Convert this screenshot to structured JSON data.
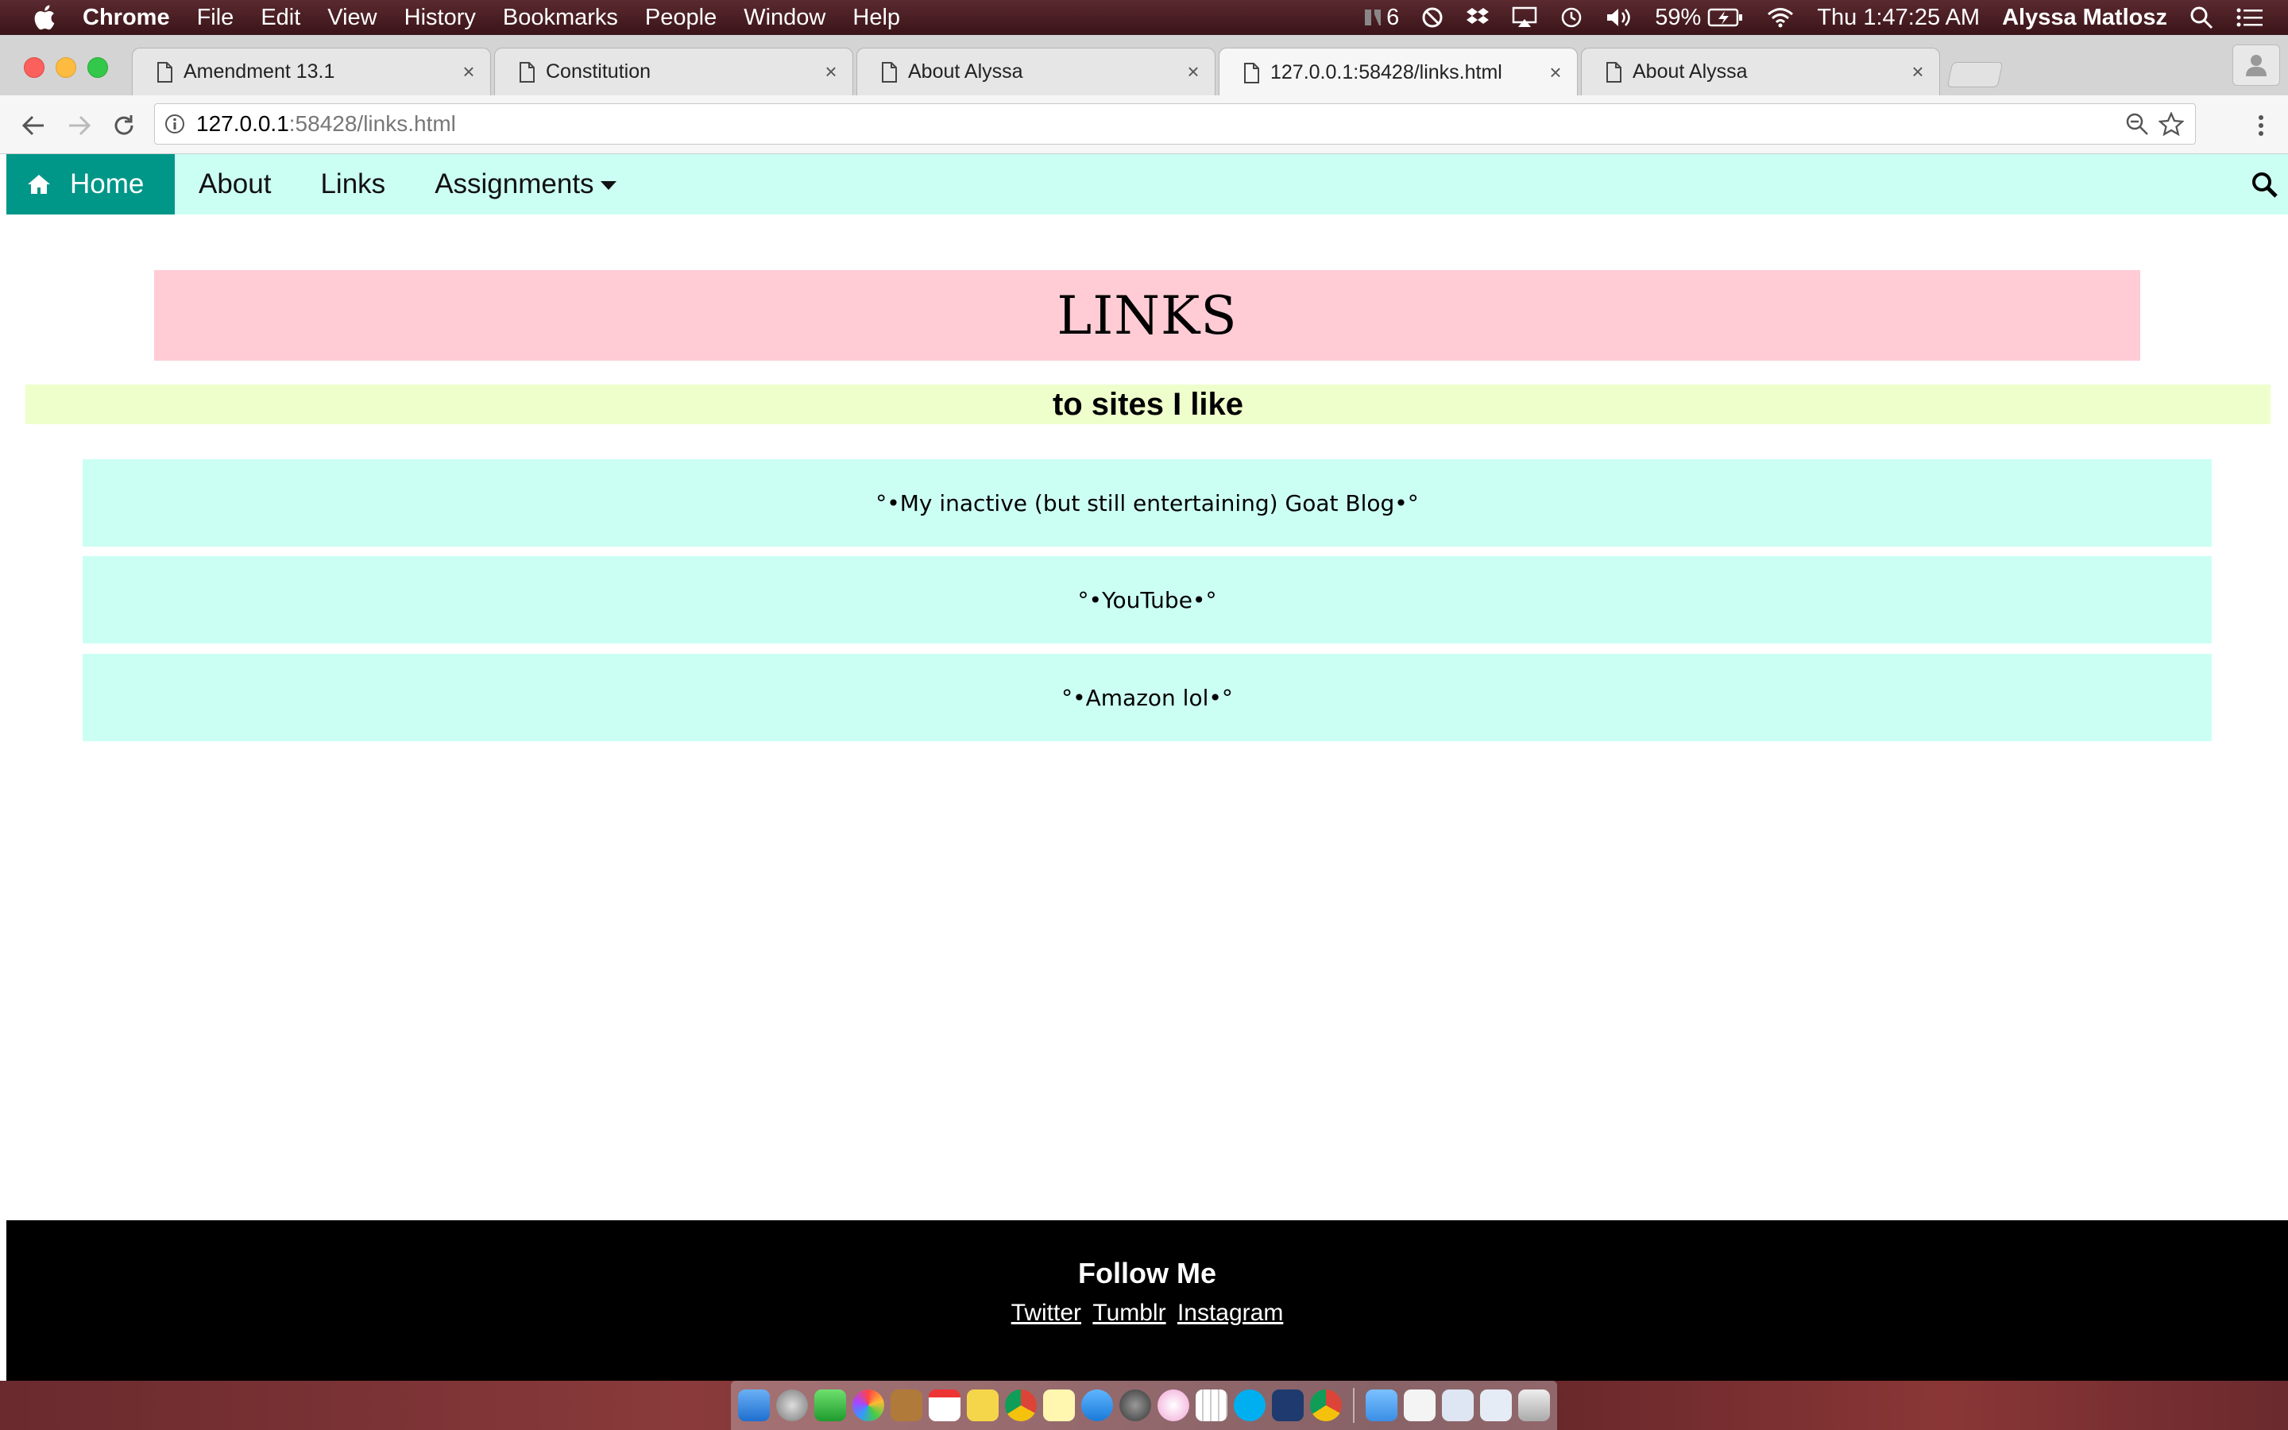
{
  "menubar": {
    "app": "Chrome",
    "items": [
      "File",
      "Edit",
      "View",
      "History",
      "Bookmarks",
      "People",
      "Window",
      "Help"
    ],
    "status": {
      "notification_count": "6",
      "battery": "59%",
      "clock": "Thu 1:47:25 AM",
      "user": "Alyssa Matlosz"
    }
  },
  "browser": {
    "tabs": [
      {
        "title": "Amendment 13.1",
        "active": false
      },
      {
        "title": "Constitution",
        "active": false
      },
      {
        "title": "About Alyssa",
        "active": false
      },
      {
        "title": "127.0.0.1:58428/links.html",
        "active": true
      },
      {
        "title": "About Alyssa",
        "active": false
      }
    ],
    "tab_close_glyph": "×",
    "url_host": "127.0.0.1",
    "url_rest": ":58428/links.html"
  },
  "site": {
    "nav": {
      "home": "Home",
      "about": "About",
      "links": "Links",
      "assignments": "Assignments"
    },
    "title": "LINKS",
    "subtitle": "to sites I like",
    "links": [
      "°•My inactive (but still entertaining) Goat Blog•°",
      "°•YouTube•°",
      "°•Amazon lol•°"
    ],
    "footer": {
      "title": "Follow Me",
      "links": [
        "Twitter",
        "Tumblr",
        "Instagram"
      ]
    }
  },
  "colors": {
    "nav_bg": "#ccfff4",
    "home_bg": "#009688",
    "title_bg": "#ffccd5",
    "subtitle_bg": "#efffcc",
    "link_bg": "#ccfff4",
    "footer_bg": "#000000"
  }
}
